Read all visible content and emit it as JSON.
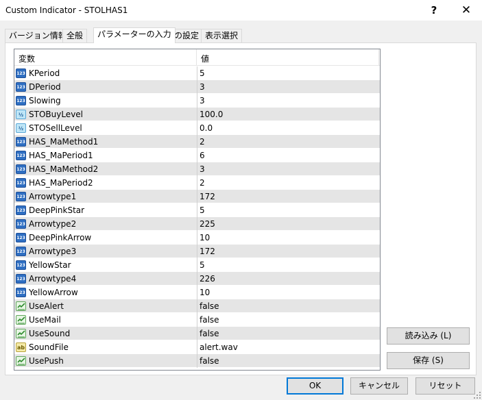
{
  "window": {
    "title": "Custom Indicator - STOLHAS1",
    "help_label": "?",
    "close_label": "✕"
  },
  "tabs": [
    {
      "label": "バージョン情報",
      "active": false
    },
    {
      "label": "全般",
      "active": false
    },
    {
      "label": "パラメーターの入力",
      "active": true
    },
    {
      "label": "色の設定",
      "active": false
    },
    {
      "label": "表示選択",
      "active": false
    }
  ],
  "grid": {
    "col_variable": "変数",
    "col_value": "値",
    "rows": [
      {
        "type": "int",
        "icon": "integer-icon",
        "name": "KPeriod",
        "value": "5"
      },
      {
        "type": "int",
        "icon": "integer-icon",
        "name": "DPeriod",
        "value": "3"
      },
      {
        "type": "int",
        "icon": "integer-icon",
        "name": "Slowing",
        "value": "3"
      },
      {
        "type": "dbl",
        "icon": "double-icon",
        "name": "STOBuyLevel",
        "value": "100.0"
      },
      {
        "type": "dbl",
        "icon": "double-icon",
        "name": "STOSellLevel",
        "value": "0.0"
      },
      {
        "type": "int",
        "icon": "integer-icon",
        "name": "HAS_MaMethod1",
        "value": "2"
      },
      {
        "type": "int",
        "icon": "integer-icon",
        "name": "HAS_MaPeriod1",
        "value": "6"
      },
      {
        "type": "int",
        "icon": "integer-icon",
        "name": "HAS_MaMethod2",
        "value": "3"
      },
      {
        "type": "int",
        "icon": "integer-icon",
        "name": "HAS_MaPeriod2",
        "value": "2"
      },
      {
        "type": "int",
        "icon": "integer-icon",
        "name": "Arrowtype1",
        "value": "172"
      },
      {
        "type": "int",
        "icon": "integer-icon",
        "name": "DeepPinkStar",
        "value": "5"
      },
      {
        "type": "int",
        "icon": "integer-icon",
        "name": "Arrowtype2",
        "value": "225"
      },
      {
        "type": "int",
        "icon": "integer-icon",
        "name": "DeepPinkArrow",
        "value": "10"
      },
      {
        "type": "int",
        "icon": "integer-icon",
        "name": "Arrowtype3",
        "value": "172"
      },
      {
        "type": "int",
        "icon": "integer-icon",
        "name": "YellowStar",
        "value": "5"
      },
      {
        "type": "int",
        "icon": "integer-icon",
        "name": "Arrowtype4",
        "value": "226"
      },
      {
        "type": "int",
        "icon": "integer-icon",
        "name": "YellowArrow",
        "value": "10"
      },
      {
        "type": "bool",
        "icon": "boolean-icon",
        "name": "UseAlert",
        "value": "false"
      },
      {
        "type": "bool",
        "icon": "boolean-icon",
        "name": "UseMail",
        "value": "false"
      },
      {
        "type": "bool",
        "icon": "boolean-icon",
        "name": "UseSound",
        "value": "false"
      },
      {
        "type": "str",
        "icon": "string-icon",
        "name": "SoundFile",
        "value": "alert.wav"
      },
      {
        "type": "bool",
        "icon": "boolean-icon",
        "name": "UsePush",
        "value": "false"
      }
    ]
  },
  "icon_text": {
    "int": "123",
    "dbl": "½",
    "str": "ab"
  },
  "buttons": {
    "load": "読み込み (L)",
    "save": "保存 (S)",
    "ok": "OK",
    "cancel": "キャンセル",
    "reset": "リセット"
  },
  "colors": {
    "row_alt": "#e5e5e5",
    "accent": "#0078d7"
  }
}
